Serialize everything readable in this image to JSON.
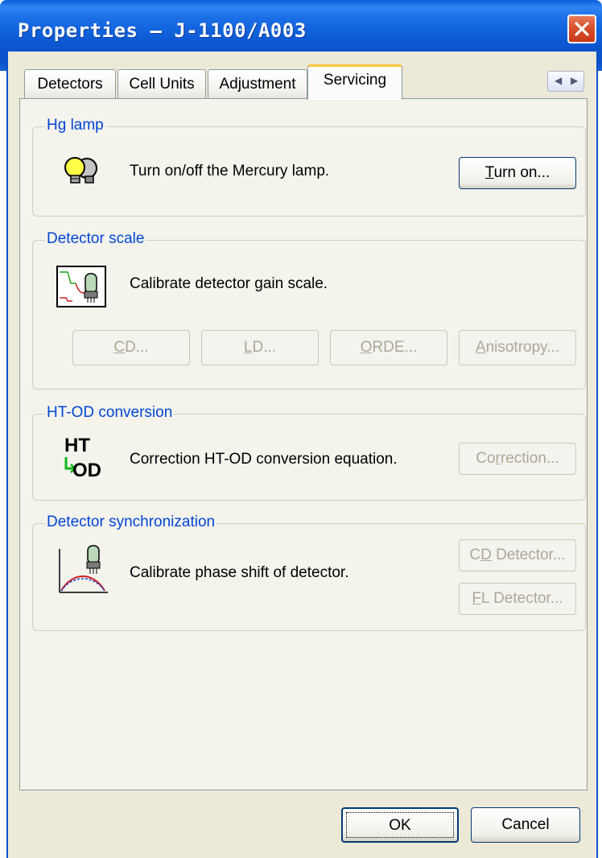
{
  "window": {
    "title": "Properties – J-1100/A003"
  },
  "tabs": [
    {
      "label": "Detectors"
    },
    {
      "label": "Cell Units"
    },
    {
      "label": "Adjustment"
    },
    {
      "label": "Servicing"
    }
  ],
  "active_tab": "Servicing",
  "hg_lamp": {
    "title": "Hg lamp",
    "description": "Turn on/off the Mercury lamp.",
    "button_prefix": "",
    "button_mnemonic": "T",
    "button_rest": "urn on...",
    "icon": "lightbulb-icon"
  },
  "detector_scale": {
    "title": "Detector scale",
    "description": "Calibrate detector gain scale.",
    "icon": "detector-scale-icon",
    "buttons": [
      {
        "mnemonic": "C",
        "rest": "D..."
      },
      {
        "mnemonic": "L",
        "rest": "D..."
      },
      {
        "mnemonic": "O",
        "rest": "RDE..."
      },
      {
        "mnemonic": "A",
        "rest": "nisotropy..."
      }
    ]
  },
  "ht_od": {
    "title": "HT-OD conversion",
    "description": "Correction HT-OD conversion equation.",
    "icon_line1": "HT",
    "icon_line2": "OD",
    "button_prefix": "Co",
    "button_mnemonic": "r",
    "button_rest": "rection..."
  },
  "sync": {
    "title": "Detector synchronization",
    "description": "Calibrate phase shift of detector.",
    "icon": "phase-shift-icon",
    "buttons": [
      {
        "prefix": "C",
        "mnemonic": "D",
        "rest": " Detector..."
      },
      {
        "prefix": "",
        "mnemonic": "F",
        "rest": "L Detector..."
      }
    ]
  },
  "footer": {
    "ok_label": "OK",
    "cancel_label": "Cancel"
  },
  "colors": {
    "titlebar": "#0a50c8",
    "group_title": "#0046d5",
    "dialog_bg": "#ece9d8",
    "tab_highlight": "#ffc83c"
  }
}
